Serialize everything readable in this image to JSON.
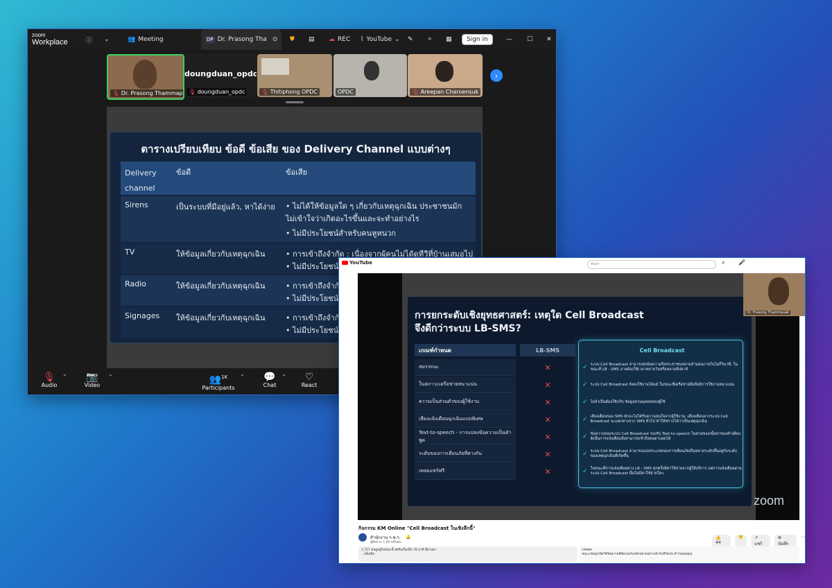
{
  "zoom": {
    "brand_top": "zoom",
    "brand_bottom": "Workplace",
    "meeting_tab": "Meeting",
    "host_badge": "DP",
    "host_tab": "Dr. Prasong Tha",
    "rec": "REC",
    "youtube": "YouTube",
    "signin": "Sign in",
    "participants": [
      {
        "name": "Dr. Prasong Thammap..."
      },
      {
        "name": "doungduan_opdc",
        "big": "doungduan_opdc"
      },
      {
        "name": "Thitiphong OPDC"
      },
      {
        "name": "OPDC"
      },
      {
        "name": "Areepan Charoensuk"
      }
    ],
    "slide": {
      "title": "ตารางเปรียบเทียบ ข้อดี ข้อเสีย ของ Delivery Channel แบบต่างๆ",
      "headers": [
        "Delivery channel",
        "ข้อดี",
        "ข้อเสีย"
      ],
      "rows": [
        {
          "channel": "Sirens",
          "pro": "เป็นระบบที่มีอยู่แล้ว, หาได้ง่าย",
          "cons": [
            "ไม่ได้ให้ข้อมูลใด ๆ เกี่ยวกับเหตุฉุกเฉิน ประชาชนมัก ไม่เข้าใจว่าเกิดอะไรขึ้นและจะทำอย่างไร",
            "ไม่มีประโยชน์สำหรับคนหูหนวก"
          ]
        },
        {
          "channel": "TV",
          "pro": "ให้ข้อมูลเกี่ยวกับเหตุฉุกเฉิน",
          "cons": [
            "การเข้าถึงจำกัด : เนื่องจากผู้คนไม่ได้ดูทีวีที่บ้านเสมอไป",
            "ไม่มีประโยชน์"
          ]
        },
        {
          "channel": "Radio",
          "pro": "ให้ข้อมูลเกี่ยวกับเหตุฉุกเฉิน",
          "cons": [
            "การเข้าถึงจำกัด",
            "ไม่มีประโยชน์"
          ]
        },
        {
          "channel": "Signages",
          "pro": "ให้ข้อมูลเกี่ยวกับเหตุฉุกเฉิน",
          "cons": [
            "การเข้าถึงจำกัด",
            "ไม่มีประโยชน์"
          ]
        }
      ]
    },
    "toolbar": {
      "audio": "Audio",
      "video": "Video",
      "participants": "Participants",
      "participants_count": "1K",
      "chat": "Chat",
      "react": "React"
    }
  },
  "youtube": {
    "logo": "YouTube",
    "search_placeholder": "ค้นหา",
    "pip_name": "Dr. Prasong Thammasak",
    "slide": {
      "title_line1": "การยกระดับเชิงยุทธศาสตร์: เหตุใด Cell Broadcast",
      "title_line2": "จึงดีกว่าระบบ LB-SMS?",
      "col_criteria": "เกณฑ์กำหนด",
      "col_lbsms": "LB-SMS",
      "col_cb": "Cell Broadcast",
      "rows": [
        {
          "criteria": "สมรรถนะ",
          "cb": "ระบบ Cell Broadcast สามารถส่งข้อความถึงประชาชนหลายล้านคนภายในไม่กี่วินาที; ในขณะที่ LB - SMS อาจต้องใช้เวลาหลายวันหรือหลายสัปดาห์"
        },
        {
          "criteria": "ในสภาวะเครือข่ายหนาแน่น",
          "cb": "ระบบ Cell Broadcast ยังคงใช้งานได้แม้ ในขณะที่เครือข่ายมือถือมีการใช้งานหนาแน่น"
        },
        {
          "criteria": "ความเป็นส่วนตัวของผู้ใช้งาน",
          "cb": "ไม่จำเป็นต้องใช้/เก็บ ข้อมูลส่วนบุคคลของผู้ใช้"
        },
        {
          "criteria": "เสียงแจ้งเตือนฉุกเฉินแบบพิเศษ",
          "cb": "เสียงเตือนของ SMS มักจะไม่ได้รับความสนใจจากผู้ใช้งาน; เสียงเตือนจากระบบ Cell Broadcast จะแตกต่างจาก SMS ทั่วไป ทำให้ทราบได้ว่าเป็นเหตุฉุกเฉิน"
        },
        {
          "criteria": "Text-to-speech - การแปลงข้อความเป็นคำพูด",
          "cb": "ข้อความของระบบ Cell Broadcast รองรับ Text-to-speech ในส่วนของเนื้อหาของคำเตือน ยังนั้นการแจ้งเตือนจึงสามารถเข้าถึงคนตาบอดได้"
        },
        {
          "criteria": "ระดับของการเตือนภัยที่ต่างกัน",
          "cb": "ระบบ Cell Broadcast สามารถแบ่งประเภทของการเตือนภัยเป็นหลายระดับขึ้นอยู่กับระดับของเหตุฉุกเฉินที่เกิดขึ้น"
        },
        {
          "criteria": "เพลยแซร์ฟรี",
          "cb": "ในขณะที่การแจ้งเตือนทาง LB - SMS ทุกครั้งมีค่าใช้จ่ายจากผู้ให้บริการ แต่การแจ้งเตือนผ่านระบบ Cell Broadcast นั้นไม่มีค่าใช้จ่ายใดๆ"
        }
      ]
    },
    "zoom_watermark": "zoom",
    "video_title": "กิจกรรม KM Online \"Cell Broadcast ในเชิงลึกนี้\"",
    "channel": "สำนักงาน ก.พ.ร.",
    "subscribers": "ผู้ติดตาม 1.09 หมื่นคน",
    "likes": "44",
    "share": "แชร์",
    "save": "บันทึก",
    "description": "1,757 คนดูอยู่ในขณะนี้  สตรีมเริ่มเมื่อ 78 นาที ที่ผ่านมา",
    "description_more": "...เพิ่มเติม",
    "sidebar_header": "แชทสด",
    "sidebar_text": "ขณะแชทถูกเปิดใช้ข้อความที่ชัดเจนกับหลักหลายอย่างเข้ากับชีวิตประจำวันของคุณ"
  }
}
